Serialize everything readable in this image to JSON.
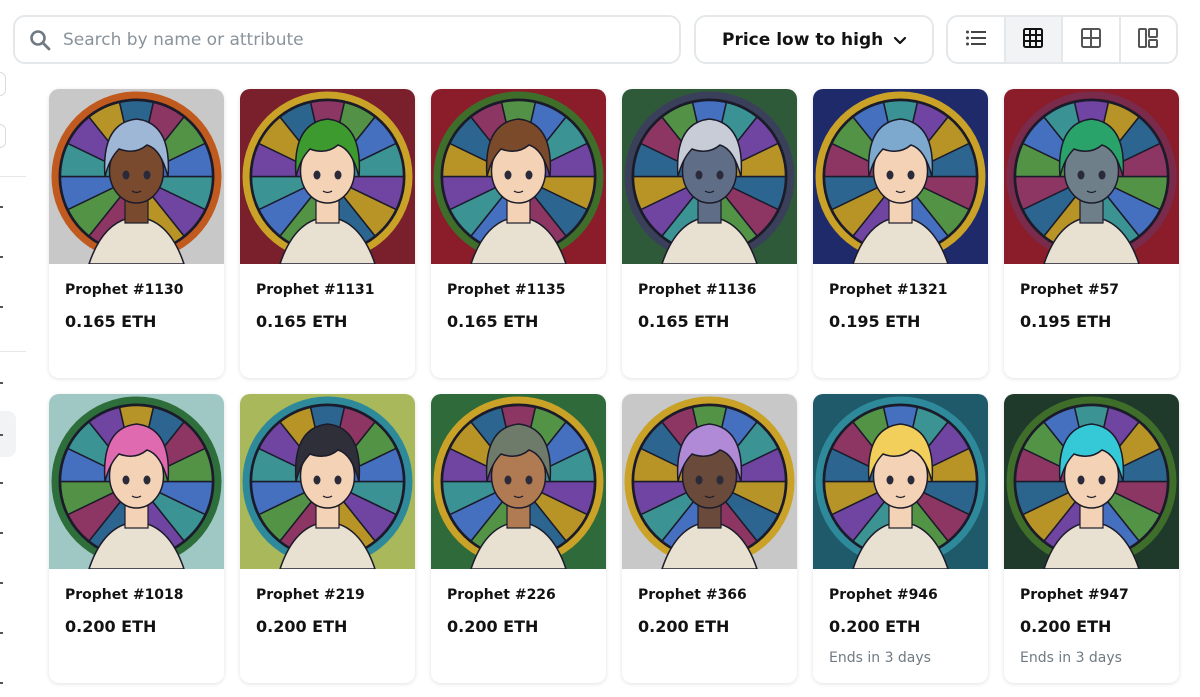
{
  "search": {
    "placeholder": "Search by name or attribute"
  },
  "sort": {
    "label": "Price low to high"
  },
  "view_modes": [
    {
      "icon": "list-view-icon",
      "active": false
    },
    {
      "icon": "large-grid-view-icon",
      "active": true
    },
    {
      "icon": "small-grid-view-icon",
      "active": false
    },
    {
      "icon": "collage-view-icon",
      "active": false
    }
  ],
  "items": [
    {
      "name": "Prophet #1130",
      "price": "0.165 ETH",
      "sub": "",
      "frame": "#c8c8c8",
      "ring": "#c05a1e",
      "hair": "#9fb7d6",
      "skin": "#7a4a2e"
    },
    {
      "name": "Prophet #1131",
      "price": "0.165 ETH",
      "sub": "",
      "frame": "#7a1f2c",
      "ring": "#c9a227",
      "hair": "#3c9a2e",
      "skin": "#f3d2b5"
    },
    {
      "name": "Prophet #1135",
      "price": "0.165 ETH",
      "sub": "",
      "frame": "#8b1c2a",
      "ring": "#3e6e2a",
      "hair": "#7a4a2a",
      "skin": "#f3d2b5"
    },
    {
      "name": "Prophet #1136",
      "price": "0.165 ETH",
      "sub": "",
      "frame": "#2f5a3a",
      "ring": "#3a3f5a",
      "hair": "#c7ccd6",
      "skin": "#5f6e86"
    },
    {
      "name": "Prophet #1321",
      "price": "0.195 ETH",
      "sub": "",
      "frame": "#1f2a6a",
      "ring": "#c9a227",
      "hair": "#7ea9cf",
      "skin": "#f3d2b5"
    },
    {
      "name": "Prophet #57",
      "price": "0.195 ETH",
      "sub": "",
      "frame": "#8b1c2a",
      "ring": "#7a2a4a",
      "hair": "#2aa36a",
      "skin": "#6e7f8a"
    },
    {
      "name": "Prophet #1018",
      "price": "0.200 ETH",
      "sub": "",
      "frame": "#9fc7c4",
      "ring": "#2e6e3a",
      "hair": "#e06ab0",
      "skin": "#f3d2b5"
    },
    {
      "name": "Prophet #219",
      "price": "0.200 ETH",
      "sub": "",
      "frame": "#a8b85a",
      "ring": "#2e8a9a",
      "hair": "#2f2f3a",
      "skin": "#f3d2b5"
    },
    {
      "name": "Prophet #226",
      "price": "0.200 ETH",
      "sub": "",
      "frame": "#2f6a3a",
      "ring": "#c9a227",
      "hair": "#6e7a6a",
      "skin": "#b07a52"
    },
    {
      "name": "Prophet #366",
      "price": "0.200 ETH",
      "sub": "",
      "frame": "#c8c8c8",
      "ring": "#c9a227",
      "hair": "#b08ad6",
      "skin": "#6a4a3a"
    },
    {
      "name": "Prophet #946",
      "price": "0.200 ETH",
      "sub": "Ends in 3 days",
      "frame": "#1f5a6a",
      "ring": "#2e8a9a",
      "hair": "#f2cf5a",
      "skin": "#f3d2b5"
    },
    {
      "name": "Prophet #947",
      "price": "0.200 ETH",
      "sub": "Ends in 3 days",
      "frame": "#1f3a2a",
      "ring": "#3e6e2a",
      "hair": "#35c8d6",
      "skin": "#f3d2b5"
    }
  ]
}
